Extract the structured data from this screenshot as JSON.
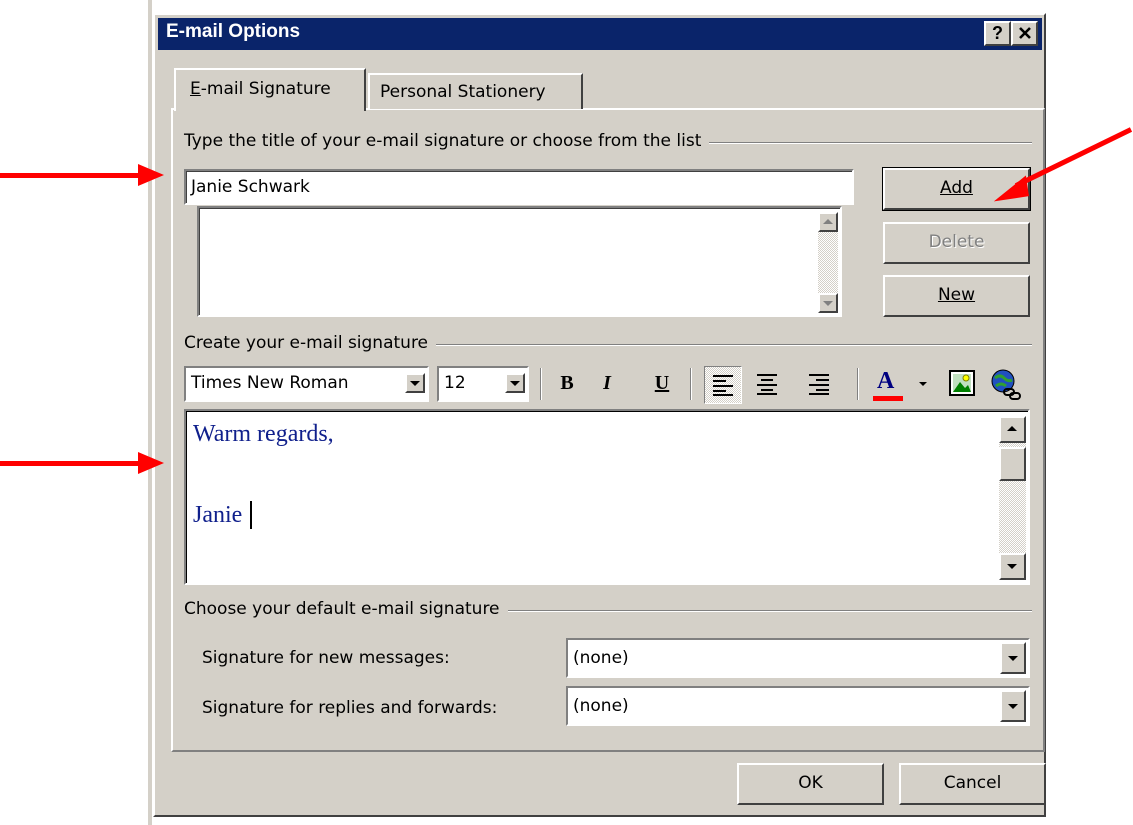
{
  "dialog": {
    "title": "E-mail Options",
    "help_glyph": "?",
    "close_glyph": "✕"
  },
  "tabs": [
    {
      "label": "E-mail Signature"
    },
    {
      "label": "Personal Stationery"
    }
  ],
  "signature_title_group": {
    "label": "Type the title of your e-mail signature or choose from the list",
    "title_input_value": "Janie Schwark",
    "list_items": []
  },
  "side_buttons": {
    "add": "Add",
    "delete": "Delete",
    "new": "New"
  },
  "create_group": {
    "label": "Create your e-mail signature",
    "font_name": "Times New Roman",
    "font_size": "12",
    "bold_glyph": "B",
    "italic_glyph": "I",
    "underline_glyph": "U",
    "font_color_glyph": "A",
    "icons": [
      "align-left-icon",
      "align-center-icon",
      "align-right-icon",
      "font-color-icon",
      "insert-picture-icon",
      "insert-hyperlink-icon"
    ]
  },
  "signature_editor": {
    "line1": "Warm regards,",
    "line2": "Janie",
    "text_color": "#10208c"
  },
  "default_group": {
    "label": "Choose your default e-mail signature",
    "new_messages_label": "Signature for new messages:",
    "new_messages_value": "(none)",
    "replies_label": "Signature for replies and forwards:",
    "replies_value": "(none)"
  },
  "footer": {
    "ok": "OK",
    "cancel": "Cancel"
  },
  "annotation_color": "#ff0000"
}
